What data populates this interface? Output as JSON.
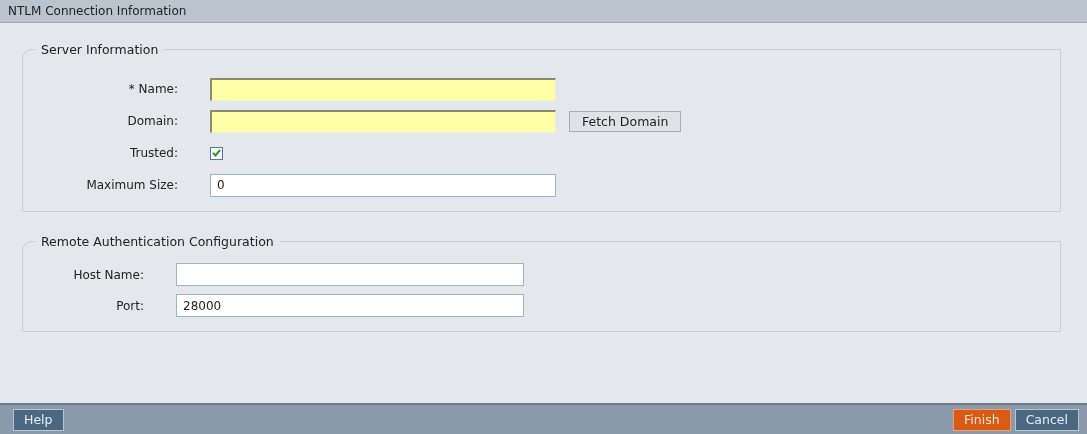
{
  "window": {
    "title": "NTLM Connection Information"
  },
  "sections": [
    {
      "title": "Server Information",
      "fields": [
        {
          "kind": "text",
          "label": "* Name:",
          "highlighted": true
        },
        {
          "kind": "text",
          "label": "Domain:",
          "highlighted": true,
          "button": "Fetch Domain"
        },
        {
          "kind": "checkbox",
          "label": "Trusted:",
          "checked": true
        },
        {
          "kind": "text",
          "label": "Maximum Size:",
          "value": "0",
          "highlighted": false
        }
      ]
    },
    {
      "title": "Remote Authentication Configuration",
      "fields": [
        {
          "kind": "text",
          "label": "Host Name:",
          "highlighted": false
        },
        {
          "kind": "text",
          "label": "Port:",
          "value": "28000",
          "highlighted": false
        }
      ]
    }
  ],
  "footer": {
    "left_buttons": [
      {
        "label": "Help",
        "kind": "secondary"
      }
    ],
    "right_buttons": [
      {
        "label": "Finish",
        "kind": "primary"
      },
      {
        "label": "Cancel",
        "kind": "secondary"
      }
    ]
  }
}
